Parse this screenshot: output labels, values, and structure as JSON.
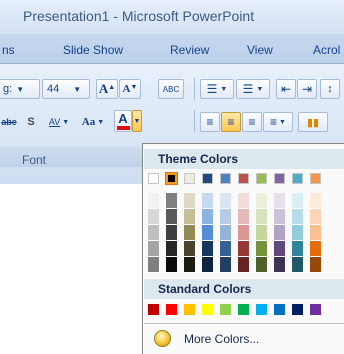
{
  "window": {
    "title": "Presentation1 - Microsoft PowerPoint"
  },
  "tabs": [
    "ns",
    "Slide Show",
    "Review",
    "View",
    "Acrol"
  ],
  "font_group": {
    "font_name_partial": "g:",
    "font_size": "44",
    "grow_label": "A",
    "shrink_label": "A",
    "clear_format_label": "ABC",
    "strike_label": "abe",
    "shadow_label": "S",
    "spacing_label": "AV",
    "case_label": "Aa",
    "font_color_label": "A",
    "group_label": "Font"
  },
  "colors": {
    "title_bar": "#dbe6f6",
    "font_color_underline": "#e01010",
    "selection_border": "#f59a1f"
  },
  "palette": {
    "theme_header": "Theme Colors",
    "standard_header": "Standard Colors",
    "more_colors": "More Colors...",
    "theme_top": [
      "#ffffff",
      "#000000",
      "#eeece1",
      "#1f497d",
      "#4f81bd",
      "#c0504d",
      "#9bbb59",
      "#8064a2",
      "#4bacc6",
      "#f79646"
    ],
    "theme_shades": [
      [
        "#f2f2f2",
        "#d8d8d8",
        "#bfbfbf",
        "#a5a5a5",
        "#7f7f7f"
      ],
      [
        "#7f7f7f",
        "#595959",
        "#3f3f3f",
        "#262626",
        "#0c0c0c"
      ],
      [
        "#ddd9c3",
        "#c4bd97",
        "#938953",
        "#494429",
        "#1d1b10"
      ],
      [
        "#c6d9f0",
        "#8db3e2",
        "#548dd4",
        "#17365d",
        "#0f243e"
      ],
      [
        "#dbe5f1",
        "#b8cce4",
        "#95b3d7",
        "#366092",
        "#244061"
      ],
      [
        "#f2dcdb",
        "#e5b9b7",
        "#d99694",
        "#953734",
        "#632423"
      ],
      [
        "#ebf1dd",
        "#d7e3bc",
        "#c3d69b",
        "#76923c",
        "#4f6128"
      ],
      [
        "#e5e0ec",
        "#ccc1d9",
        "#b2a2c7",
        "#5f497a",
        "#3f3151"
      ],
      [
        "#dbeef3",
        "#b7dde8",
        "#92cddc",
        "#31859b",
        "#205867"
      ],
      [
        "#fdeada",
        "#fbd5b5",
        "#fac08f",
        "#e36c09",
        "#974806"
      ]
    ],
    "standard": [
      "#c00000",
      "#ff0000",
      "#ffc000",
      "#ffff00",
      "#92d050",
      "#00b050",
      "#00b0f0",
      "#0070c0",
      "#002060",
      "#7030a0"
    ],
    "selected_index": 1
  }
}
